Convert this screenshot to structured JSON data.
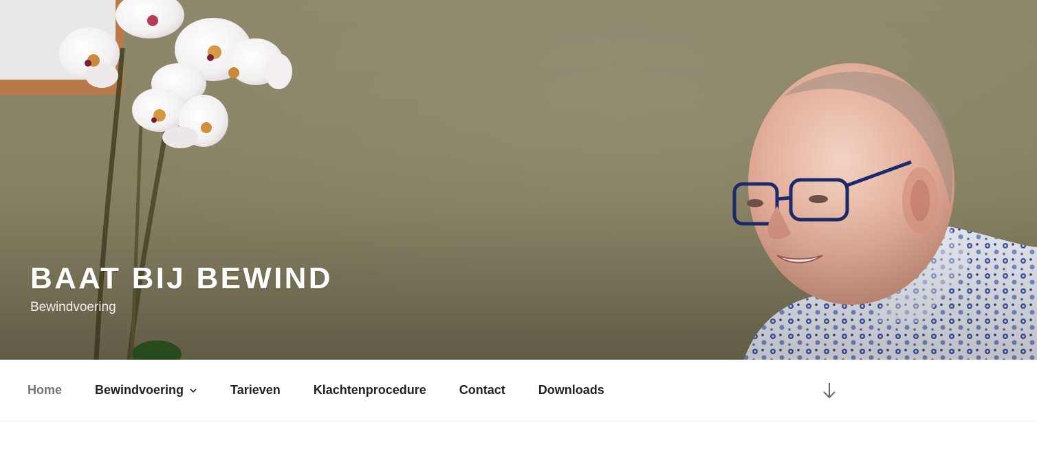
{
  "site": {
    "title": "BAAT BIJ BEWIND",
    "description": "Bewindvoering"
  },
  "nav": {
    "items": [
      {
        "label": "Home",
        "current": true
      },
      {
        "label": "Bewindvoering",
        "has_dropdown": true
      },
      {
        "label": "Tarieven"
      },
      {
        "label": "Klachtenprocedure"
      },
      {
        "label": "Contact"
      },
      {
        "label": "Downloads"
      }
    ],
    "scroll_icon": "arrow-down-icon",
    "dropdown_icon": "chevron-down-icon"
  },
  "hero": {
    "image_subject": "header-photo"
  },
  "colors": {
    "nav_text": "#222222",
    "nav_current": "#767676",
    "title": "#ffffff",
    "wall": "#8a8466"
  }
}
